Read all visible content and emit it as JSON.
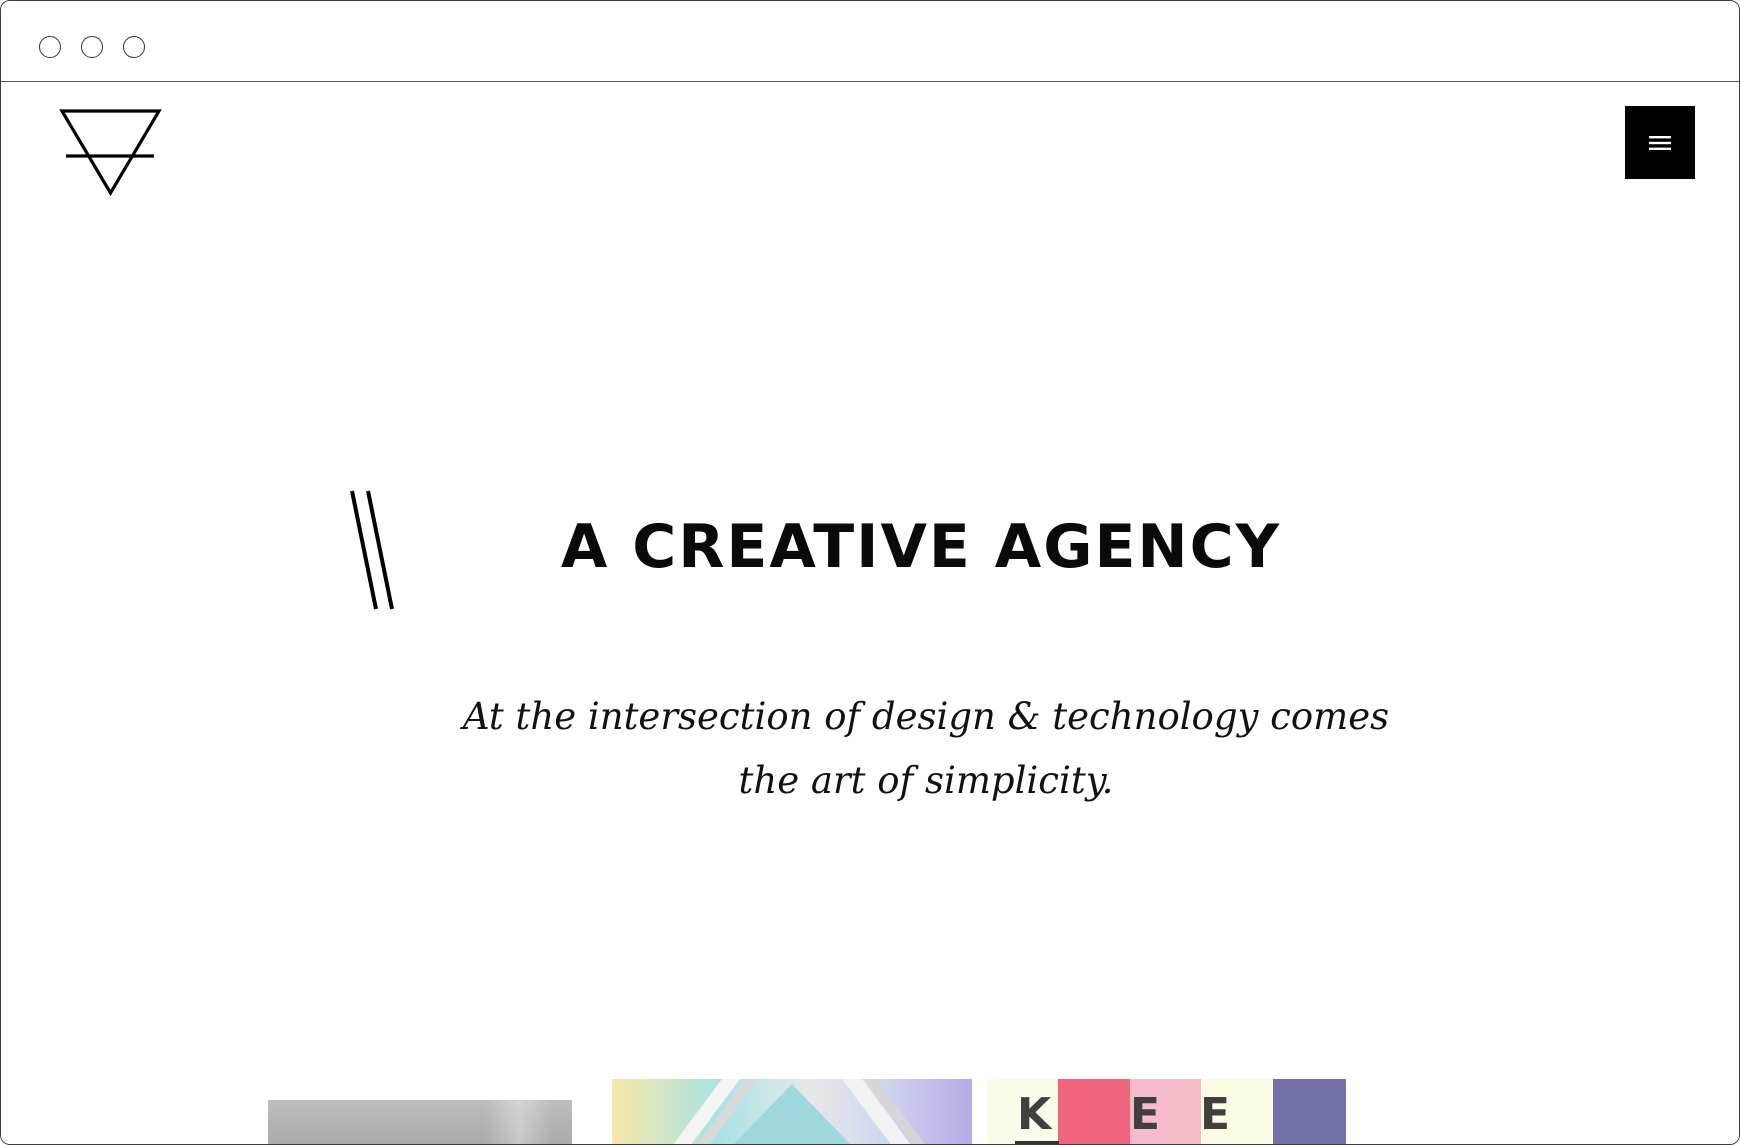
{
  "browser": {
    "controls": [
      "close",
      "minimize",
      "maximize"
    ]
  },
  "header": {
    "logo_icon": "inverted-triangle-crossbar-logo",
    "menu_icon": "hamburger-menu-icon"
  },
  "hero": {
    "decoration_icon": "double-slash-icon",
    "title": "A CREATIVE AGENCY",
    "subtitle_line1": "At the intersection of design & technology comes",
    "subtitle_line2": "the art of simplicity."
  },
  "portfolio": {
    "thumbnails": [
      {
        "name": "grey-photo"
      },
      {
        "name": "pastel-geometric"
      },
      {
        "name": "kee-color-blocks",
        "letters": [
          "K",
          "E",
          "E"
        ]
      }
    ]
  },
  "colors": {
    "accent": "#000000",
    "background": "#ffffff",
    "kee_red": "#f0677d",
    "kee_pink": "#f6bcca",
    "kee_cream": "#fcfbe4",
    "kee_purple": "#7371a8"
  }
}
